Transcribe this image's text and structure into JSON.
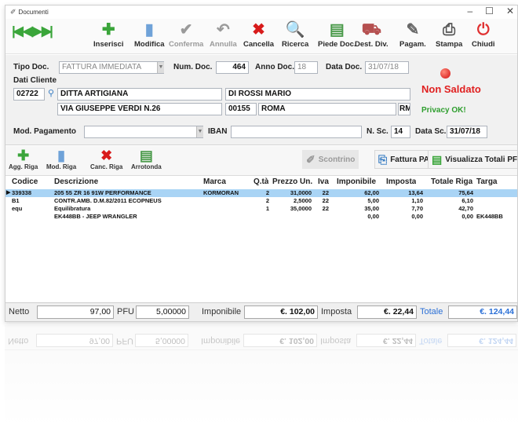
{
  "window": {
    "title": "Documenti",
    "controls": [
      "–",
      "☐",
      "✕"
    ]
  },
  "toolbar": {
    "nav": [
      "first",
      "prev",
      "next",
      "last"
    ],
    "buttons": [
      {
        "label": "Inserisci",
        "icon": "plus-icon",
        "glyph": "✚",
        "color": "#3aa53a",
        "disabled": false
      },
      {
        "label": "Modifica",
        "icon": "edit-document-icon",
        "glyph": "▮",
        "color": "#6fa2d8",
        "disabled": false
      },
      {
        "label": "Conferma",
        "icon": "checkmark-icon",
        "glyph": "✔",
        "color": "#9a9a9a",
        "disabled": true
      },
      {
        "label": "Annulla",
        "icon": "undo-icon",
        "glyph": "↶",
        "color": "#9a9a9a",
        "disabled": true
      },
      {
        "label": "Cancella",
        "icon": "delete-x-icon",
        "glyph": "✖",
        "color": "#d81b1b",
        "disabled": false
      },
      {
        "label": "Ricerca",
        "icon": "magnifier-icon",
        "glyph": "🔍",
        "color": "#3b7fc4",
        "disabled": false
      },
      {
        "label": "Piede Doc.",
        "icon": "document-footer-icon",
        "glyph": "▤",
        "color": "#4a9a4a",
        "disabled": false
      },
      {
        "label": "Dest. Div.",
        "icon": "destination-icon",
        "glyph": "⛟",
        "color": "#b55050",
        "disabled": false
      },
      {
        "label": "Pagam.",
        "icon": "payment-icon",
        "glyph": "✎",
        "color": "#666666",
        "disabled": false
      },
      {
        "label": "Stampa",
        "icon": "printer-icon",
        "glyph": "⎙",
        "color": "#555555",
        "disabled": false
      },
      {
        "label": "Chiudi",
        "icon": "power-icon",
        "glyph": "⏻",
        "color": "#e03030",
        "disabled": false
      }
    ]
  },
  "header": {
    "tipo_doc_label": "Tipo Doc.",
    "tipo_doc_value": "FATTURA IMMEDIATA",
    "num_doc_label": "Num. Doc.",
    "num_doc_value": "464",
    "anno_doc_label": "Anno Doc.",
    "anno_doc_value": "18",
    "data_doc_label": "Data Doc.",
    "data_doc_value": "31/07/18",
    "dati_cliente_label": "Dati Cliente",
    "cliente_codice": "02722",
    "cliente_ragione": "DITTA ARTIGIANA",
    "cliente_referente": "DI ROSSI MARIO",
    "cliente_indirizzo": "VIA GIUSEPPE VERDI N.26",
    "cliente_cap": "00155",
    "cliente_citta": "ROMA",
    "cliente_prov": "RM",
    "status": "Non Saldato",
    "privacy": "Privacy OK!",
    "mod_pagamento_label": "Mod. Pagamento",
    "mod_pagamento_value": "",
    "iban_label": "IBAN",
    "iban_value": "",
    "n_sc_label": "N. Sc.",
    "n_sc_value": "14",
    "data_sc_label": "Data Sc.",
    "data_sc_value": "31/07/18"
  },
  "rowbar": {
    "buttons": [
      {
        "label": "Agg. Riga",
        "icon": "add-row-icon",
        "glyph": "✚",
        "color": "#3aa53a"
      },
      {
        "label": "Mod. Riga",
        "icon": "edit-row-icon",
        "glyph": "▮",
        "color": "#6fa2d8"
      },
      {
        "label": "Canc. Riga",
        "icon": "delete-row-icon",
        "glyph": "✖",
        "color": "#d81b1b"
      },
      {
        "label": "Arrotonda",
        "icon": "round-icon",
        "glyph": "▤",
        "color": "#4a9a4a"
      }
    ],
    "scontrino": "Scontrino",
    "fattura_pa": "Fattura PA",
    "visualizza_totali": "Visualizza Totali PFU"
  },
  "grid": {
    "columns": [
      "Codice",
      "Descrizione",
      "Marca",
      "Q.tà",
      "Prezzo Un.",
      "Iva",
      "Imponibile",
      "Imposta",
      "Totale Riga",
      "Targa"
    ],
    "rows": [
      {
        "codice": "339338",
        "descrizione": "205 55 ZR 16  91W PERFORMANCE",
        "marca": "KORMORAN",
        "qta": "2",
        "prezzo": "31,0000",
        "iva": "22",
        "imponibile": "62,00",
        "imposta": "13,64",
        "totale": "75,64",
        "targa": "",
        "selected": true
      },
      {
        "codice": "B1",
        "descrizione": "CONTR.AMB. D.M.82/2011 ECOPNEUS",
        "marca": "",
        "qta": "2",
        "prezzo": "2,5000",
        "iva": "22",
        "imponibile": "5,00",
        "imposta": "1,10",
        "totale": "6,10",
        "targa": "",
        "selected": false
      },
      {
        "codice": "equ",
        "descrizione": "Equilibratura",
        "marca": "",
        "qta": "1",
        "prezzo": "35,0000",
        "iva": "22",
        "imponibile": "35,00",
        "imposta": "7,70",
        "totale": "42,70",
        "targa": "",
        "selected": false
      },
      {
        "codice": "",
        "descrizione": "EK448BB - JEEP WRANGLER",
        "marca": "",
        "qta": "",
        "prezzo": "",
        "iva": "",
        "imponibile": "0,00",
        "imposta": "0,00",
        "totale": "0,00",
        "targa": "EK448BB",
        "selected": false
      }
    ]
  },
  "footer": {
    "netto_label": "Netto",
    "netto_value": "97,00",
    "pfu_label": "PFU",
    "pfu_value": "5,00000",
    "imponibile_label": "Imponibile",
    "imponibile_value": "€. 102,00",
    "imposta_label": "Imposta",
    "imposta_value": "€. 22,44",
    "totale_label": "Totale",
    "totale_value": "€. 124,44"
  }
}
